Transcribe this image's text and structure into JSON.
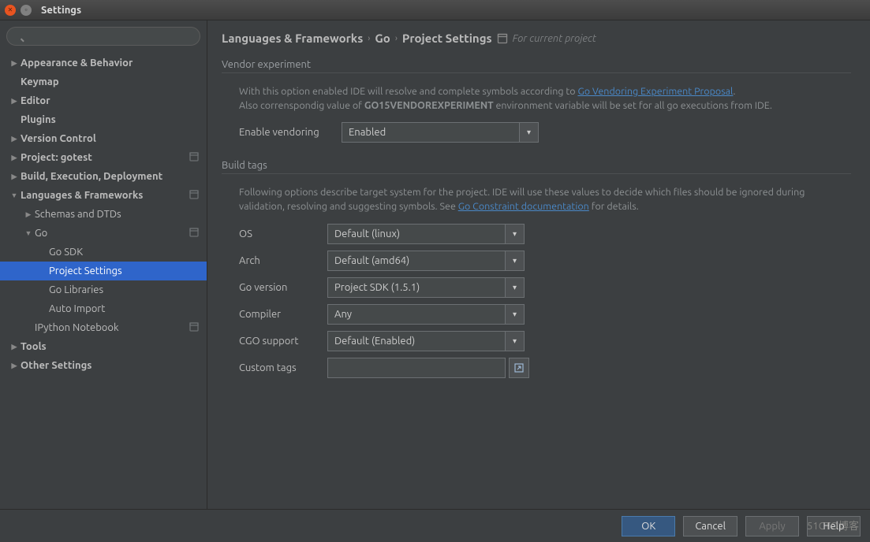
{
  "window": {
    "title": "Settings"
  },
  "sidebar": {
    "search_placeholder": "",
    "items": [
      {
        "label": "Appearance & Behavior",
        "bold": true,
        "level": 0,
        "caret": "▶"
      },
      {
        "label": "Keymap",
        "bold": true,
        "level": 0,
        "caret": ""
      },
      {
        "label": "Editor",
        "bold": true,
        "level": 0,
        "caret": "▶"
      },
      {
        "label": "Plugins",
        "bold": true,
        "level": 0,
        "caret": ""
      },
      {
        "label": "Version Control",
        "bold": true,
        "level": 0,
        "caret": "▶"
      },
      {
        "label": "Project: gotest",
        "bold": true,
        "level": 0,
        "caret": "▶",
        "badge": true
      },
      {
        "label": "Build, Execution, Deployment",
        "bold": true,
        "level": 0,
        "caret": "▶"
      },
      {
        "label": "Languages & Frameworks",
        "bold": true,
        "level": 0,
        "caret": "▼",
        "badge": true
      },
      {
        "label": "Schemas and DTDs",
        "bold": false,
        "level": 1,
        "caret": "▶"
      },
      {
        "label": "Go",
        "bold": false,
        "level": 1,
        "caret": "▼",
        "badge": true
      },
      {
        "label": "Go SDK",
        "bold": false,
        "level": 2,
        "caret": "",
        "noCaret": true
      },
      {
        "label": "Project Settings",
        "bold": false,
        "level": 2,
        "caret": "",
        "noCaret": true,
        "selected": true
      },
      {
        "label": "Go Libraries",
        "bold": false,
        "level": 2,
        "caret": "",
        "noCaret": true
      },
      {
        "label": "Auto Import",
        "bold": false,
        "level": 2,
        "caret": "",
        "noCaret": true
      },
      {
        "label": "IPython Notebook",
        "bold": false,
        "level": 1,
        "caret": "",
        "noCaret1": true,
        "badge": true
      },
      {
        "label": "Tools",
        "bold": true,
        "level": 0,
        "caret": "▶"
      },
      {
        "label": "Other Settings",
        "bold": true,
        "level": 0,
        "caret": "▶"
      }
    ]
  },
  "breadcrumb": {
    "a": "Languages & Frameworks",
    "b": "Go",
    "c": "Project Settings",
    "hint": "For current project"
  },
  "vendor": {
    "header": "Vendor experiment",
    "desc1a": "With this option enabled IDE will resolve and complete symbols according to ",
    "desc1link": "Go Vendoring Experiment Proposal",
    "desc1b": ".",
    "desc2a": "Also correnspondig value of ",
    "desc2env": "GO15VENDOREXPERIMENT",
    "desc2b": " environment variable will be set for all go executions from IDE.",
    "enable_label": "Enable vendoring",
    "enable_value": "Enabled"
  },
  "build": {
    "header": "Build tags",
    "desc_a": "Following options describe target system for the project. IDE will use these values to decide which files should be ignored during validation, resolving and suggesting symbols. See ",
    "desc_link": "Go Constraint documentation",
    "desc_b": " for details.",
    "os_label": "OS",
    "os_value": "Default (linux)",
    "arch_label": "Arch",
    "arch_value": "Default (amd64)",
    "gover_label": "Go version",
    "gover_value": "Project SDK (1.5.1)",
    "compiler_label": "Compiler",
    "compiler_value": "Any",
    "cgo_label": "CGO support",
    "cgo_value": "Default (Enabled)",
    "custom_label": "Custom tags",
    "custom_value": ""
  },
  "footer": {
    "ok": "OK",
    "cancel": "Cancel",
    "apply": "Apply",
    "help": "Help"
  },
  "watermark": "51CTO博客"
}
